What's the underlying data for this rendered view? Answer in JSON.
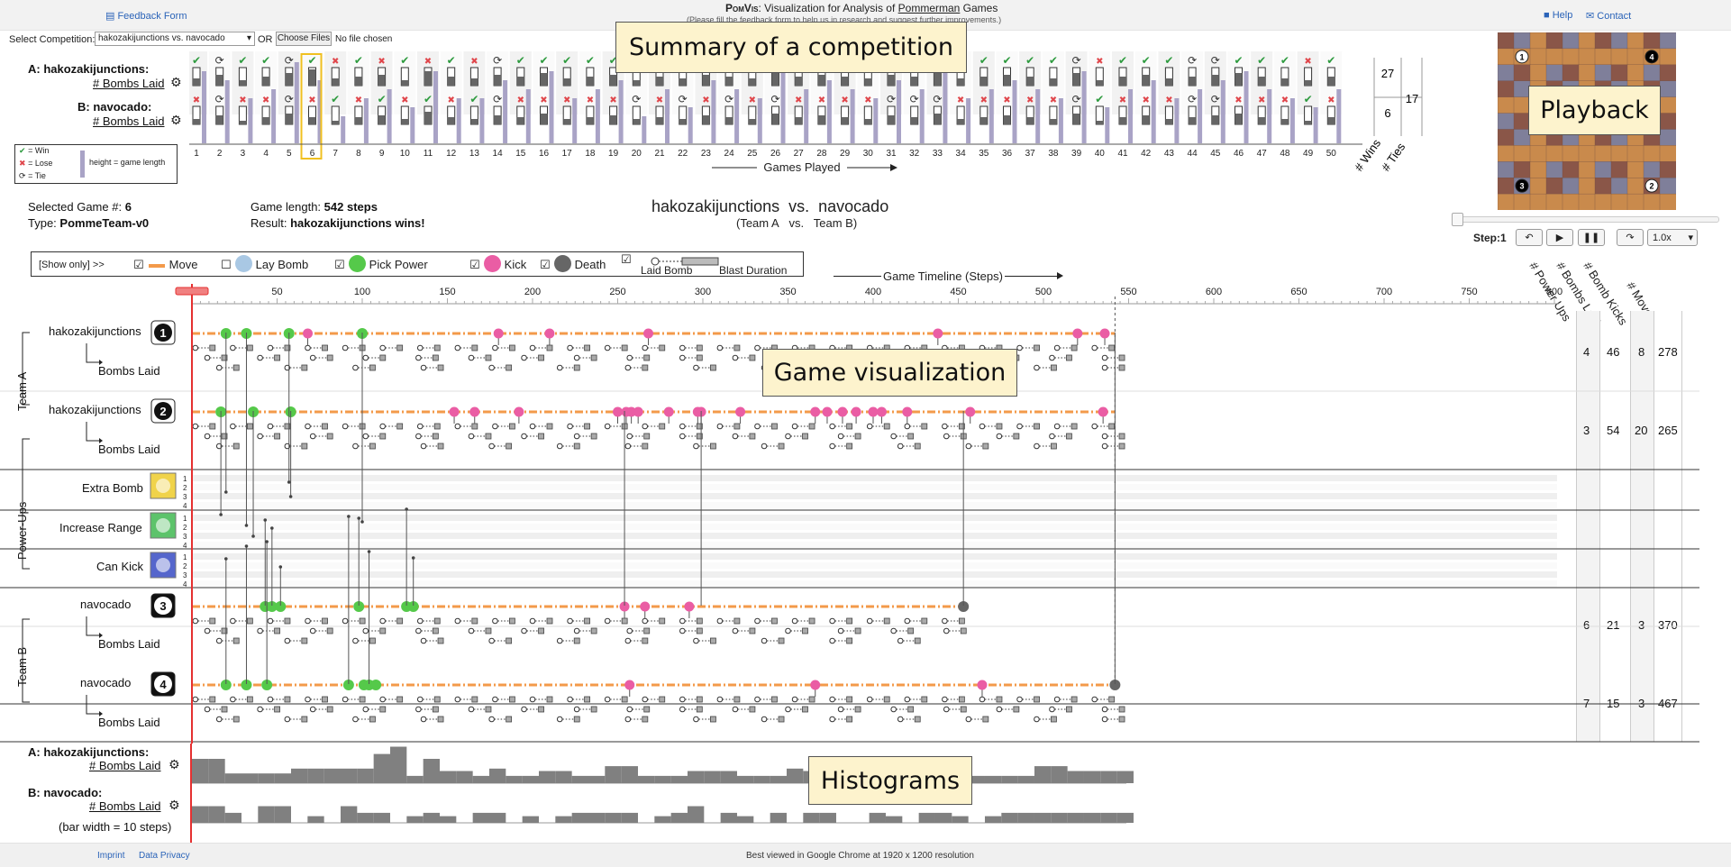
{
  "header": {
    "feedback_link": "Feedback Form",
    "app_name": "PomVis",
    "title_rest": ": Visualization for Analysis of ",
    "title_game": "Pommerman",
    "title_end": " Games",
    "subtitle": "(Please fill the feedback form to help us in research and suggest further improvements.)",
    "help": "Help",
    "contact": "Contact"
  },
  "selector": {
    "label": "Select Competition:",
    "value": "hakozakijunctions vs. navocado",
    "or": "OR",
    "choose": "Choose Files",
    "no_file": "No file chosen"
  },
  "summary": {
    "team_a_label": "A: hakozakijunctions:",
    "team_b_label": "B: navocado:",
    "metric_label": "# Bombs Laid",
    "legend_win": "= Win",
    "legend_lose": "= Lose",
    "legend_tie": "= Tie",
    "legend_height": "height = game length",
    "games_played": "Games Played",
    "wins_a": "27",
    "wins_b": "6",
    "ties": "17",
    "wins_label": "# Wins",
    "ties_label": "# Ties",
    "selected_index": 6,
    "results_a": [
      "W",
      "T",
      "W",
      "W",
      "T",
      "W",
      "L",
      "W",
      "L",
      "W",
      "L",
      "W",
      "L",
      "T",
      "W",
      "W",
      "W",
      "W",
      "W",
      "T",
      "W",
      "T",
      "W",
      "T",
      "W",
      "T",
      "W",
      "W",
      "W",
      "W",
      "T",
      "T",
      "T",
      "W",
      "W",
      "W",
      "W",
      "W",
      "T",
      "L",
      "W",
      "W",
      "W",
      "T",
      "T",
      "W",
      "W",
      "W",
      "L",
      "W"
    ],
    "results_b": [
      "L",
      "T",
      "L",
      "L",
      "T",
      "L",
      "W",
      "L",
      "W",
      "L",
      "W",
      "L",
      "W",
      "T",
      "L",
      "L",
      "L",
      "L",
      "L",
      "T",
      "L",
      "T",
      "L",
      "T",
      "L",
      "T",
      "L",
      "L",
      "L",
      "L",
      "T",
      "T",
      "T",
      "L",
      "L",
      "L",
      "L",
      "L",
      "T",
      "W",
      "L",
      "L",
      "L",
      "T",
      "T",
      "L",
      "L",
      "L",
      "W",
      "L"
    ],
    "bombs_a": [
      0.4,
      0.6,
      0.3,
      0.5,
      0.7,
      0.9,
      0.4,
      0.5,
      0.6,
      0.3,
      0.8,
      0.5,
      0.4,
      0.6,
      0.5,
      0.7,
      0.4,
      0.5,
      0.6,
      0.3,
      0.5,
      0.4,
      0.6,
      0.5,
      0.4,
      0.7,
      0.5,
      0.6,
      0.5,
      0.4,
      0.6,
      0.5,
      0.7,
      0.4,
      0.5,
      0.6,
      0.5,
      0.4,
      0.7,
      0.3,
      0.5,
      0.6,
      0.4,
      0.5,
      0.6,
      0.7,
      0.5,
      0.4,
      0.3,
      0.5
    ],
    "bombs_b": [
      0.3,
      0.5,
      0.2,
      0.4,
      0.6,
      0.4,
      0.2,
      0.4,
      0.5,
      0.3,
      0.7,
      0.4,
      0.3,
      0.5,
      0.4,
      0.6,
      0.3,
      0.4,
      0.5,
      0.3,
      0.4,
      0.3,
      0.5,
      0.4,
      0.3,
      0.6,
      0.4,
      0.5,
      0.4,
      0.3,
      0.5,
      0.4,
      0.6,
      0.3,
      0.4,
      0.5,
      0.4,
      0.3,
      0.6,
      0.2,
      0.4,
      0.5,
      0.3,
      0.4,
      0.5,
      0.6,
      0.4,
      0.3,
      0.2,
      0.4
    ],
    "game_length": [
      0.8,
      0.7,
      0.5,
      0.6,
      0.9,
      0.7,
      0.3,
      0.5,
      0.6,
      0.4,
      0.8,
      0.5,
      0.5,
      0.7,
      0.6,
      0.8,
      0.5,
      0.6,
      0.7,
      0.3,
      0.6,
      0.4,
      0.7,
      0.6,
      0.5,
      0.8,
      0.6,
      0.7,
      0.6,
      0.5,
      0.7,
      0.6,
      0.8,
      0.5,
      0.6,
      0.7,
      0.6,
      0.5,
      0.8,
      0.4,
      0.6,
      0.7,
      0.5,
      0.6,
      0.7,
      0.8,
      0.6,
      0.5,
      0.4,
      0.6
    ]
  },
  "callouts": {
    "summary": "Summary of a competition",
    "playback": "Playback",
    "game_vis": "Game visualization",
    "histograms": "Histograms"
  },
  "game_info": {
    "selected_label": "Selected Game #:",
    "selected_value": "6",
    "type_label": "Type:",
    "type_value": "PommeTeam-v0",
    "length_label": "Game length:",
    "length_value": "542 steps",
    "result_label": "Result:",
    "result_value": "hakozakijunctions wins!",
    "team_a": "hakozakijunctions",
    "vs": "vs.",
    "team_b": "navocado",
    "sub_a": "(Team A",
    "sub_vs": "vs.",
    "sub_b": "Team B)"
  },
  "filter": {
    "show_only": "[Show only] >>",
    "move": "Move",
    "lay_bomb": "Lay Bomb",
    "pick_power": "Pick Power",
    "kick": "Kick",
    "death": "Death",
    "laid_bomb": "Laid Bomb",
    "blast_duration": "Blast Duration"
  },
  "timeline": {
    "label": "Game Timeline (Steps)",
    "ticks": [
      "50",
      "100",
      "150",
      "200",
      "250",
      "300",
      "350",
      "400",
      "450",
      "500",
      "550",
      "600",
      "650",
      "700",
      "750",
      "800"
    ],
    "length": 542
  },
  "playback": {
    "step_label": "Step:",
    "step_value": "1",
    "speed": "1.0x",
    "agents": [
      "1",
      "4",
      "3",
      "2"
    ]
  },
  "rows": {
    "team_a": "Team A",
    "team_b": "Team B",
    "power_ups": "Power-Ups",
    "bombs_laid": "Bombs Laid",
    "agent1": {
      "name": "hakozakijunctions",
      "num": "1"
    },
    "agent2": {
      "name": "hakozakijunctions",
      "num": "2"
    },
    "agent3": {
      "name": "navocado",
      "num": "3"
    },
    "agent4": {
      "name": "navocado",
      "num": "4"
    },
    "extra_bomb": "Extra Bomb",
    "increase_range": "Increase Range",
    "can_kick": "Can Kick",
    "pu_ticks": [
      "1",
      "2",
      "3",
      "4"
    ]
  },
  "stats": {
    "headers": [
      "# Power Ups",
      "# Bombs Laid",
      "# Bomb Kicks",
      "# Moves"
    ],
    "agent1": [
      "4",
      "46",
      "8",
      "278"
    ],
    "agent2": [
      "3",
      "54",
      "20",
      "265"
    ],
    "agent3": [
      "6",
      "21",
      "3",
      "370"
    ],
    "agent4": [
      "7",
      "15",
      "3",
      "467"
    ]
  },
  "histograms": {
    "team_a_label": "A: hakozakijunctions:",
    "team_b_label": "B: navocado:",
    "metric_label": "# Bombs Laid",
    "bar_width_note": "(bar width = 10 steps)",
    "bars_a": [
      1,
      1,
      0.4,
      0.4,
      0.4,
      0.4,
      0.6,
      0.6,
      0.6,
      0.6,
      0.6,
      1.2,
      1.5,
      0.3,
      1,
      0.5,
      0.5,
      0.3,
      0.6,
      0.3,
      0.3,
      0.5,
      0.5,
      0.3,
      0.3,
      0.7,
      0.7,
      0.3,
      0.3,
      0.3,
      0.5,
      0.5,
      0.5,
      0.3,
      0.3,
      0.3,
      0.6,
      0.5,
      0.3,
      0.3,
      0.5,
      0.3,
      0.3,
      0.3,
      0.3,
      0.3,
      0.3,
      0.3,
      0.3,
      0.3,
      0.3,
      0.7,
      0.7,
      0.5,
      0.5,
      0.5,
      0.5
    ],
    "bars_b": [
      0.5,
      0.5,
      0.3,
      0,
      0.5,
      0.5,
      0,
      0.2,
      0,
      0.5,
      0.3,
      0.3,
      0,
      0.2,
      0.3,
      0.2,
      0,
      0.3,
      0.3,
      0,
      0.2,
      0,
      0.2,
      0.3,
      0.3,
      0.3,
      0.3,
      0,
      0.2,
      0.3,
      0.5,
      0,
      0.3,
      0.2,
      0,
      0.3,
      0,
      0.3,
      0.3,
      0,
      0,
      0.3,
      0.2,
      0,
      0.3,
      0.3,
      0.2,
      0,
      0.2,
      0.3,
      0.3,
      0.3,
      0.3,
      0.3,
      0.3,
      0.3,
      0.3
    ]
  },
  "footer": {
    "imprint": "Imprint",
    "privacy": "Data Privacy",
    "best_viewed": "Best viewed in Google Chrome at 1920 x 1200 resolution"
  },
  "colors": {
    "move": "#f39a4a",
    "pick": "#55c94a",
    "kick": "#ea5da4",
    "death": "#666666",
    "lay": "#a9c8e4",
    "win": "#2e9b3f",
    "lose": "#e0474c",
    "bar": "#a9a3c6",
    "selected": "#f0c020",
    "red": "#e53030"
  },
  "events": {
    "agent1": {
      "pick": [
        20,
        32,
        57,
        100
      ],
      "kick": [
        68,
        180,
        210,
        268,
        438,
        520,
        536
      ],
      "death": []
    },
    "agent2": {
      "pick": [
        17,
        36,
        58
      ],
      "kick": [
        154,
        166,
        192,
        250,
        255,
        258,
        262,
        280,
        297,
        299,
        322,
        366,
        373,
        382,
        390,
        400,
        405,
        420,
        457,
        535
      ],
      "death": []
    },
    "agent3": {
      "pick": [
        43,
        47,
        52,
        98,
        126,
        130
      ],
      "kick": [
        254,
        266,
        292
      ],
      "death": [
        453
      ]
    },
    "agent4": {
      "pick": [
        20,
        32,
        44,
        92,
        101,
        104,
        108
      ],
      "kick": [
        257,
        366,
        464
      ],
      "death": [
        542
      ]
    }
  }
}
